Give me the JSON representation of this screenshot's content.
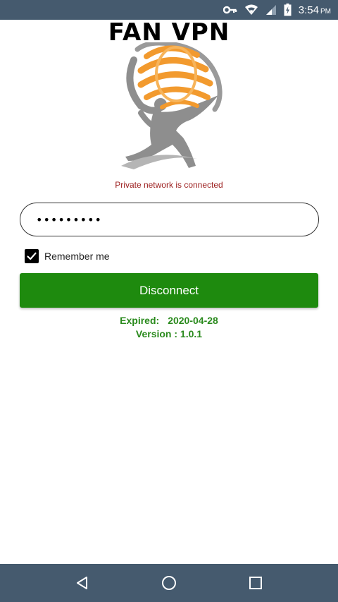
{
  "status_bar": {
    "time": "3:54",
    "ampm": "PM",
    "icons": [
      "vpn-key-icon",
      "wifi-icon",
      "cell-signal-icon",
      "battery-charging-icon"
    ]
  },
  "app": {
    "title": "FAN VPN",
    "logo_icon": "atlas-globe-logo"
  },
  "connection": {
    "status_message": "Private network is connected"
  },
  "login": {
    "password_value": "•••••••••",
    "remember_label": "Remember me",
    "remember_checked": true
  },
  "actions": {
    "disconnect_label": "Disconnect"
  },
  "info": {
    "expired_label": "Expired:",
    "expired_value": "2020-04-28",
    "version_text": "Version : 1.0.1"
  },
  "colors": {
    "bar": "#455a6e",
    "button": "#1e8a0e",
    "info_text": "#2a8a1d",
    "status_text": "#9b1c1c",
    "logo_orange": "#f29a2e"
  },
  "nav_bar": {
    "icons": [
      "back-icon",
      "home-icon",
      "recents-icon"
    ]
  }
}
